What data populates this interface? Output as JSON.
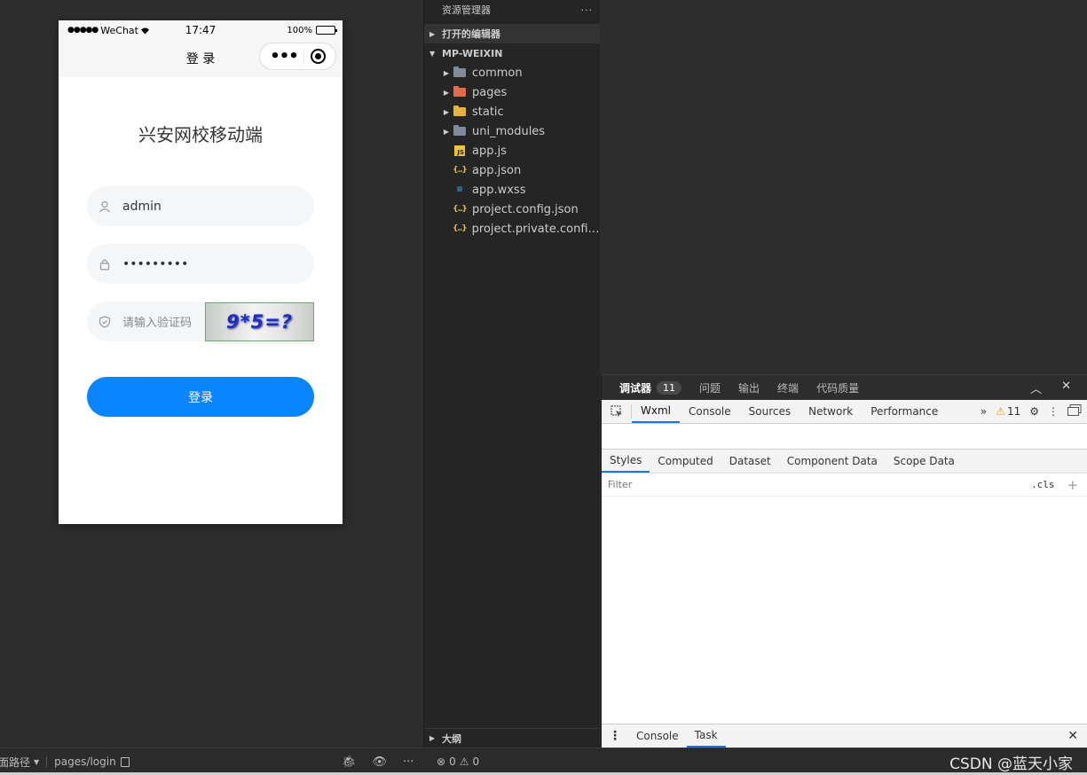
{
  "phone": {
    "status": {
      "carrier": "WeChat",
      "time": "17:47",
      "battery": "100%"
    },
    "nav_title": "登 录",
    "title": "兴安网校移动端",
    "username": "admin",
    "password_mask": "•••••••••",
    "captcha_placeholder": "请输入验证码",
    "captcha_text": "9*5=?",
    "login_button": "登录"
  },
  "explorer": {
    "title": "资源管理器",
    "open_editors": "打开的编辑器",
    "project": "MP-WEIXIN",
    "folders": [
      {
        "name": "common",
        "icon": "folder-icon"
      },
      {
        "name": "pages",
        "icon": "pages-folder-icon"
      },
      {
        "name": "static",
        "icon": "static-folder-icon"
      },
      {
        "name": "uni_modules",
        "icon": "folder-icon"
      }
    ],
    "files": [
      {
        "name": "app.js",
        "icon": "js-file-icon"
      },
      {
        "name": "app.json",
        "icon": "json-file-icon"
      },
      {
        "name": "app.wxss",
        "icon": "css-file-icon"
      },
      {
        "name": "project.config.json",
        "icon": "json-file-icon"
      },
      {
        "name": "project.private.config.js...",
        "icon": "json-file-icon"
      }
    ],
    "outline": "大纲"
  },
  "debugger": {
    "tabs": [
      {
        "label": "调试器",
        "count": "11"
      },
      {
        "label": "问题"
      },
      {
        "label": "输出"
      },
      {
        "label": "终端"
      },
      {
        "label": "代码质量"
      }
    ],
    "devtools_tabs": [
      "Wxml",
      "Console",
      "Sources",
      "Network",
      "Performance"
    ],
    "warnings": "11",
    "style_tabs": [
      "Styles",
      "Computed",
      "Dataset",
      "Component Data",
      "Scope Data"
    ],
    "filter_placeholder": "Filter",
    "cls_label": ".cls",
    "drawer_tabs": [
      "Console",
      "Task"
    ]
  },
  "statusbar": {
    "route_label": "面路径",
    "path": "pages/login",
    "errors": "0",
    "warnings": "0",
    "watermark": "CSDN @蓝天小家"
  },
  "colors": {
    "primary_button": "#0a84ff",
    "ide_background": "#2d2d2d",
    "explorer_background": "#252526",
    "active_tab_underline": "#1a73e8"
  }
}
